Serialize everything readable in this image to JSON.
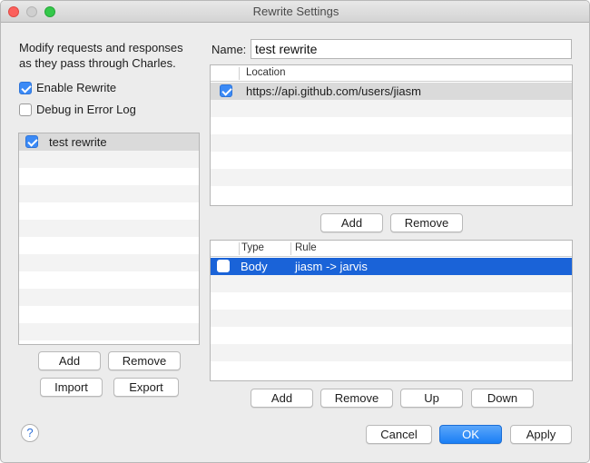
{
  "window": {
    "title": "Rewrite Settings"
  },
  "left": {
    "description_line1": "Modify requests and responses",
    "description_line2": "as they pass through Charles.",
    "enable_rewrite": {
      "label": "Enable Rewrite",
      "checked": true
    },
    "debug_log": {
      "label": "Debug in Error Log",
      "checked": false
    },
    "sets": [
      {
        "name": "test rewrite",
        "enabled": true
      }
    ],
    "buttons": {
      "add": "Add",
      "remove": "Remove",
      "import": "Import",
      "export": "Export"
    }
  },
  "right": {
    "name_label": "Name:",
    "name_value": "test rewrite",
    "locations": {
      "header_location": "Location",
      "rows": [
        {
          "enabled": true,
          "location": "https://api.github.com/users/jiasm"
        }
      ],
      "buttons": {
        "add": "Add",
        "remove": "Remove"
      }
    },
    "rules": {
      "header_type": "Type",
      "header_rule": "Rule",
      "rows": [
        {
          "enabled": true,
          "type": "Body",
          "rule": "jiasm -> jarvis"
        }
      ],
      "buttons": {
        "add": "Add",
        "remove": "Remove",
        "up": "Up",
        "down": "Down"
      }
    }
  },
  "footer": {
    "help": "?",
    "cancel": "Cancel",
    "ok": "OK",
    "apply": "Apply"
  },
  "colors": {
    "accent": "#3b8af6",
    "selection": "#1a63d8"
  }
}
